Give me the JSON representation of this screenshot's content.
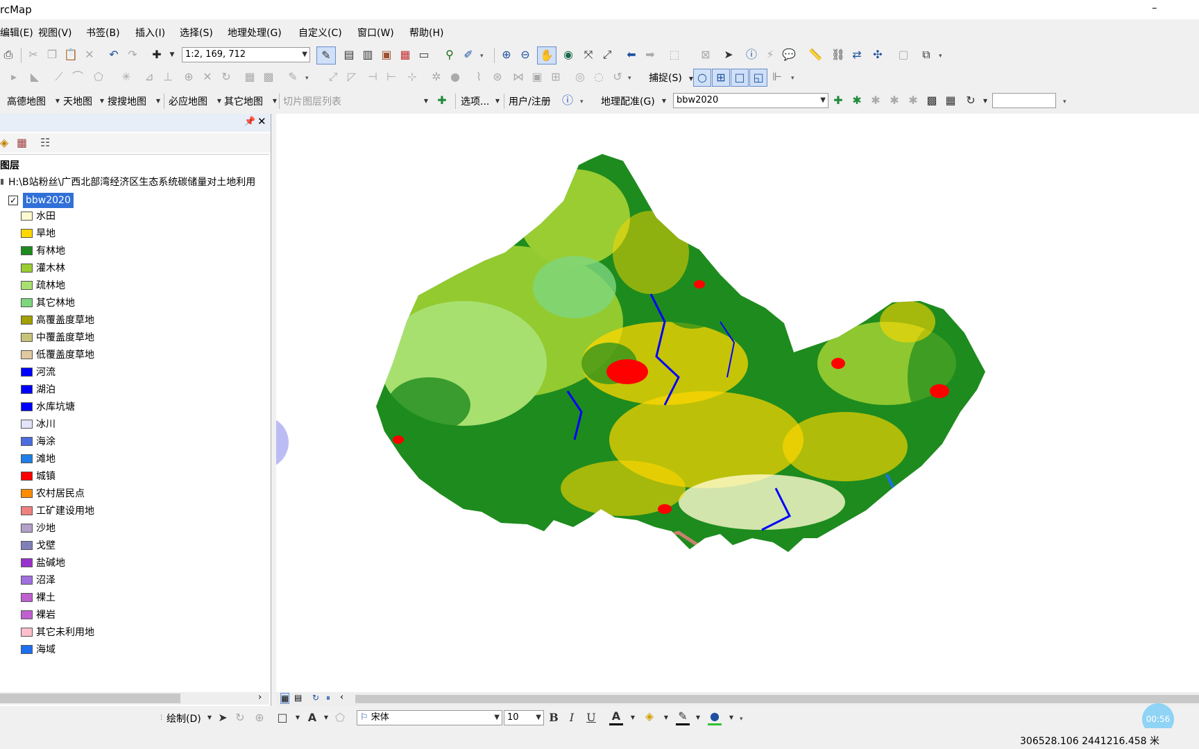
{
  "window": {
    "title": "rcMap",
    "minimize": "–"
  },
  "menu": [
    "编辑(E)",
    "视图(V)",
    "书签(B)",
    "插入(I)",
    "选择(S)",
    "地理处理(G)",
    "自定义(C)",
    "窗口(W)",
    "帮助(H)"
  ],
  "toolbar1": {
    "scale": "1:2, 169, 712"
  },
  "toolbar2": {
    "snap_label": "捕捉(S)"
  },
  "toolbar3": {
    "basemaps": [
      "高德地图",
      "天地图",
      "搜搜地图",
      "必应地图",
      "其它地图"
    ],
    "tile_list_placeholder": "切片图层列表",
    "options": "选项...",
    "user_login": "用户/注册",
    "georef": "地理配准(G)",
    "georef_layer": "bbw2020"
  },
  "toc": {
    "root_label": "图层",
    "path": "H:\\B站粉丝\\广西北部湾经济区生态系统碳储量对土地利用",
    "layer_name": "bbw2020",
    "legend": [
      {
        "label": "水田",
        "color": "#fffbd0"
      },
      {
        "label": "旱地",
        "color": "#ffd700"
      },
      {
        "label": "有林地",
        "color": "#1e8b1e"
      },
      {
        "label": "灌木林",
        "color": "#9acd32"
      },
      {
        "label": "疏林地",
        "color": "#a8e070"
      },
      {
        "label": "其它林地",
        "color": "#7ed67e"
      },
      {
        "label": "高覆盖度草地",
        "color": "#a3a000"
      },
      {
        "label": "中覆盖度草地",
        "color": "#c7c47a"
      },
      {
        "label": "低覆盖度草地",
        "color": "#e0c8a0"
      },
      {
        "label": "河流",
        "color": "#0000ff"
      },
      {
        "label": "湖泊",
        "color": "#0000ff"
      },
      {
        "label": "水库坑塘",
        "color": "#0000ff"
      },
      {
        "label": "冰川",
        "color": "#e4e4f8"
      },
      {
        "label": "海涂",
        "color": "#4a6ee0"
      },
      {
        "label": "滩地",
        "color": "#1e7fe6"
      },
      {
        "label": "城镇",
        "color": "#ff0000"
      },
      {
        "label": "农村居民点",
        "color": "#ff8c00"
      },
      {
        "label": "工矿建设用地",
        "color": "#f08080"
      },
      {
        "label": "沙地",
        "color": "#b4a0c8"
      },
      {
        "label": "戈壁",
        "color": "#8080b8"
      },
      {
        "label": "盐碱地",
        "color": "#9932cc"
      },
      {
        "label": "沼泽",
        "color": "#a070e0"
      },
      {
        "label": "裸土",
        "color": "#c060d0"
      },
      {
        "label": "裸岩",
        "color": "#c060d0"
      },
      {
        "label": "其它未利用地",
        "color": "#ffc0cb"
      },
      {
        "label": "海域",
        "color": "#1e6ef0"
      }
    ]
  },
  "drawing": {
    "draw_label": "绘制(D)",
    "font": "宋体",
    "size": "10"
  },
  "status": {
    "coords": "306528.106  2441216.458 米"
  },
  "timer": "00:56"
}
